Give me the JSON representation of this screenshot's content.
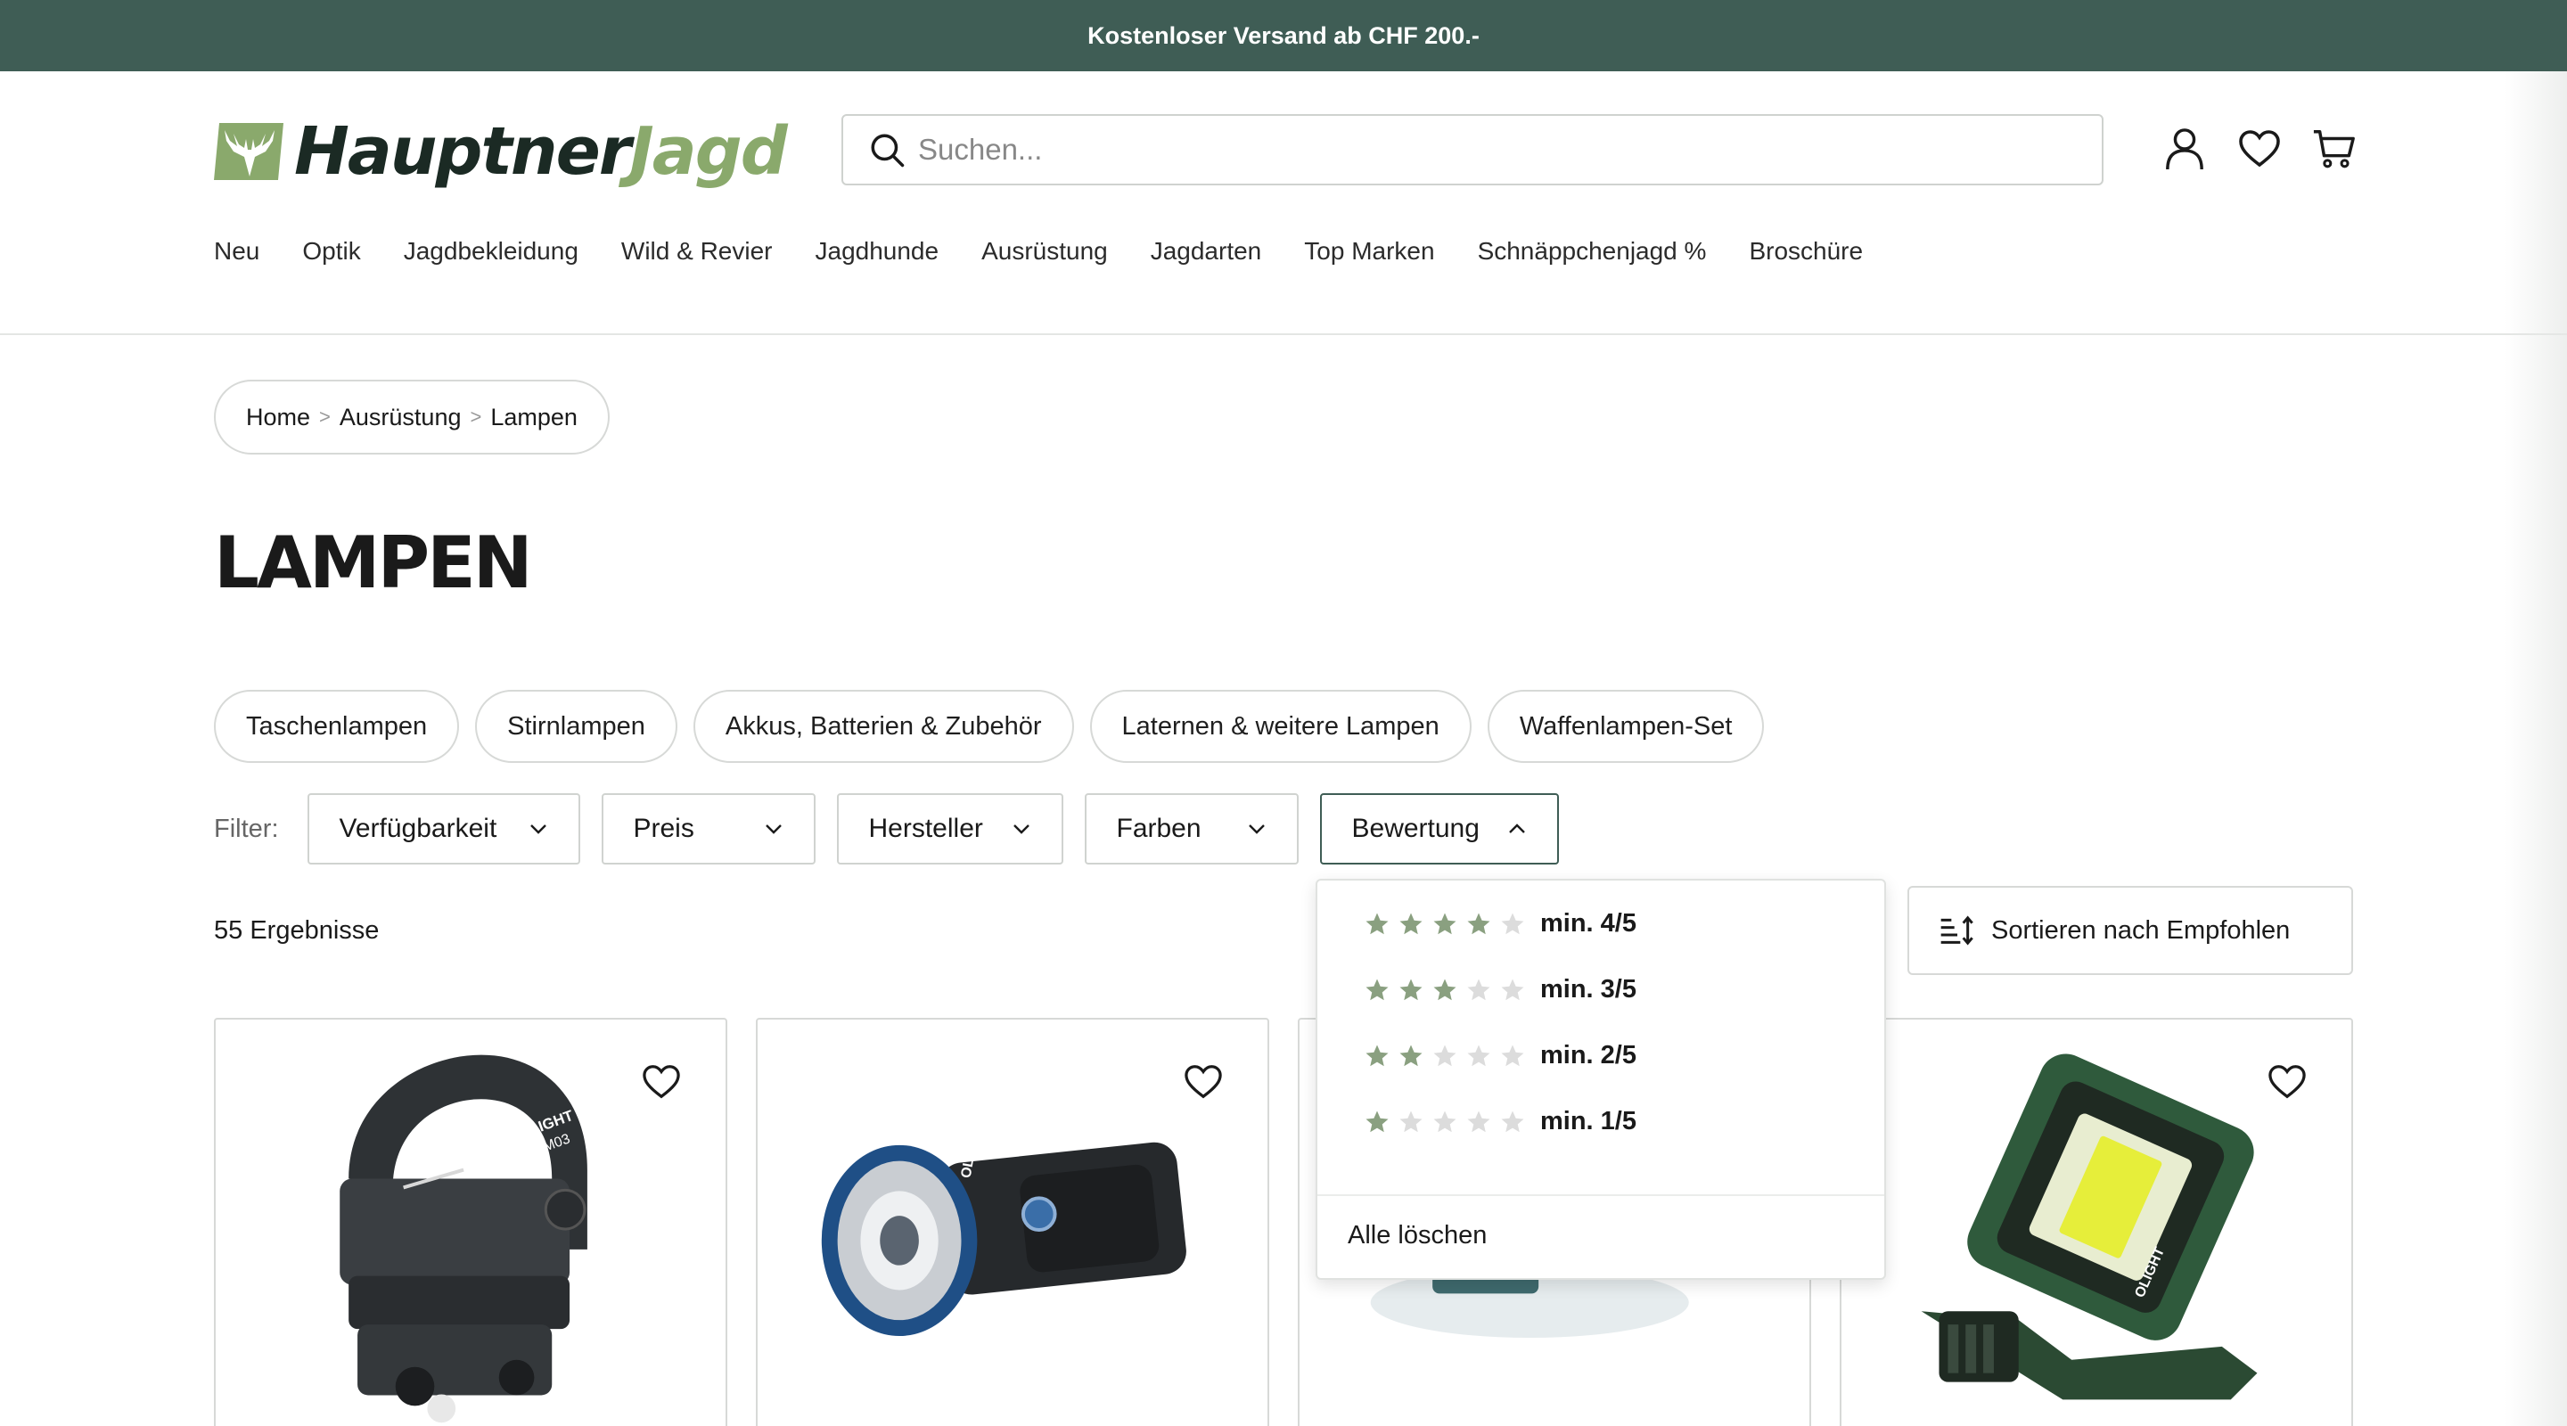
{
  "topbar": {
    "text": "Kostenloser Versand ab CHF 200.-"
  },
  "brand": {
    "name_a": "Hauptner",
    "name_b": "Jagd",
    "accent_color": "#8aa96c",
    "dark_color": "#1b2a24",
    "banner_color": "#3f5d55"
  },
  "search": {
    "placeholder": "Suchen...",
    "icon": "search-icon"
  },
  "header_icons": [
    "user-icon",
    "heart-icon",
    "cart-icon"
  ],
  "nav": [
    "Neu",
    "Optik",
    "Jagdbekleidung",
    "Wild & Revier",
    "Jagdhunde",
    "Ausrüstung",
    "Jagdarten",
    "Top Marken",
    "Schnäppchenjagd %",
    "Broschüre"
  ],
  "breadcrumb": [
    "Home",
    "Ausrüstung",
    "Lampen"
  ],
  "page_title": "LAMPEN",
  "categories": [
    "Taschenlampen",
    "Stirnlampen",
    "Akkus, Batterien & Zubehör",
    "Laternen & weitere Lampen",
    "Waffenlampen-Set"
  ],
  "filters": {
    "label": "Filter:",
    "items": [
      {
        "label": "Verfügbarkeit",
        "open": false
      },
      {
        "label": "Preis",
        "open": false
      },
      {
        "label": "Hersteller",
        "open": false
      },
      {
        "label": "Farben",
        "open": false
      },
      {
        "label": "Bewertung",
        "open": true
      }
    ]
  },
  "rating_dropdown": {
    "options": [
      {
        "label": "min. 4/5",
        "stars": 4
      },
      {
        "label": "min. 3/5",
        "stars": 3
      },
      {
        "label": "min. 2/5",
        "stars": 2
      },
      {
        "label": "min. 1/5",
        "stars": 1
      }
    ],
    "max_stars": 5,
    "clear": "Alle löschen",
    "star_color": "#8aa080",
    "star_empty_color": "#dcdcdc"
  },
  "results": {
    "text": "55 Ergebnisse"
  },
  "sort": {
    "label": "Sortieren nach Empfohlen"
  },
  "products": [
    {
      "image": "olight-x-wm03-mount",
      "brand_label": "OLIGHT",
      "model_label": "X-WM03"
    },
    {
      "image": "olight-marauder-flashlight",
      "brand_label": "OLIGHT"
    },
    {
      "image": "lantern-partial"
    },
    {
      "image": "olight-swivel-worklight",
      "brand_label": "OLIGHT"
    }
  ]
}
